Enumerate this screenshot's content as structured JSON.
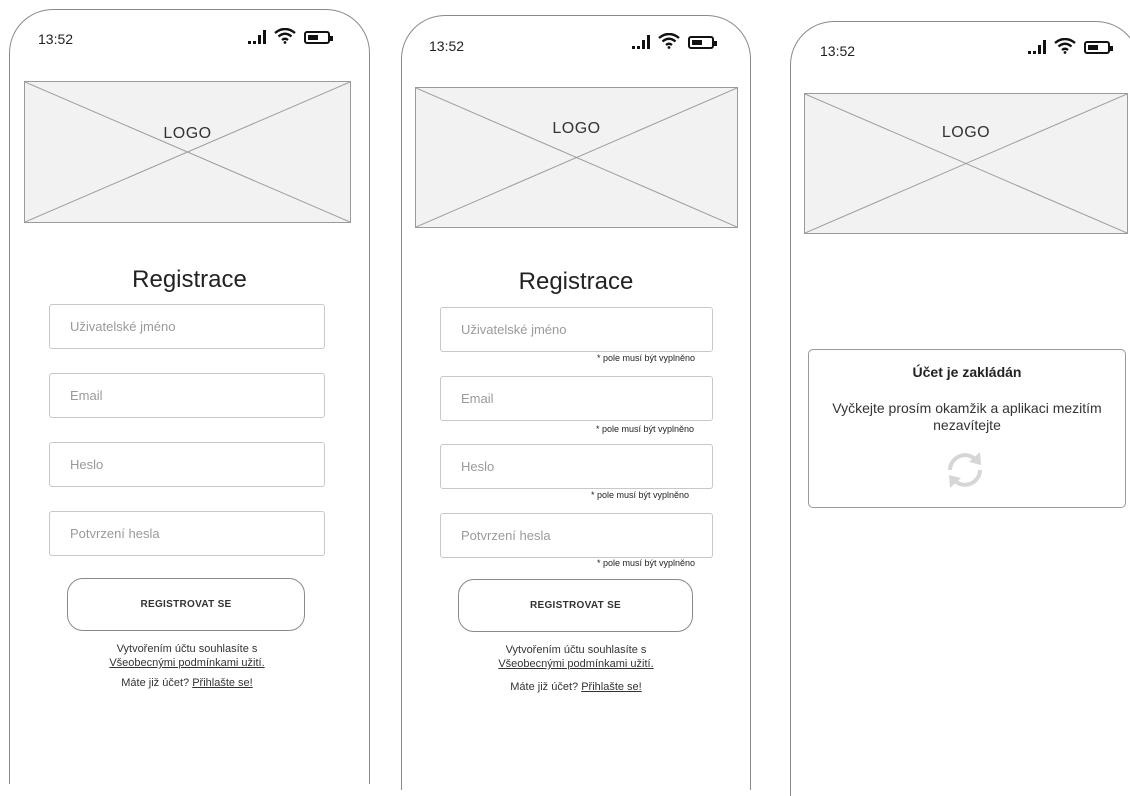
{
  "status_bar": {
    "time": "13:52"
  },
  "logo": {
    "text": "LOGO"
  },
  "registration": {
    "title": "Registrace",
    "fields": [
      {
        "placeholder": "Uživatelské jméno"
      },
      {
        "placeholder": "Email"
      },
      {
        "placeholder": "Heslo"
      },
      {
        "placeholder": "Potvrzení hesla"
      }
    ],
    "required_note": "* pole musí být vyplněno",
    "button": "REGISTROVAT SE",
    "terms_line1": "Vytvořením účtu souhlasíte s",
    "terms_link": "Všeobecnými podmínkami užití.",
    "login_prompt": "Máte již účet?",
    "login_link": "Přihlašte se!"
  },
  "loading_dialog": {
    "title": "Účet je zakládán",
    "message": "Vyčkejte prosím okamžik a aplikaci mezitím nezavítejte",
    "icon": "refresh-icon"
  }
}
